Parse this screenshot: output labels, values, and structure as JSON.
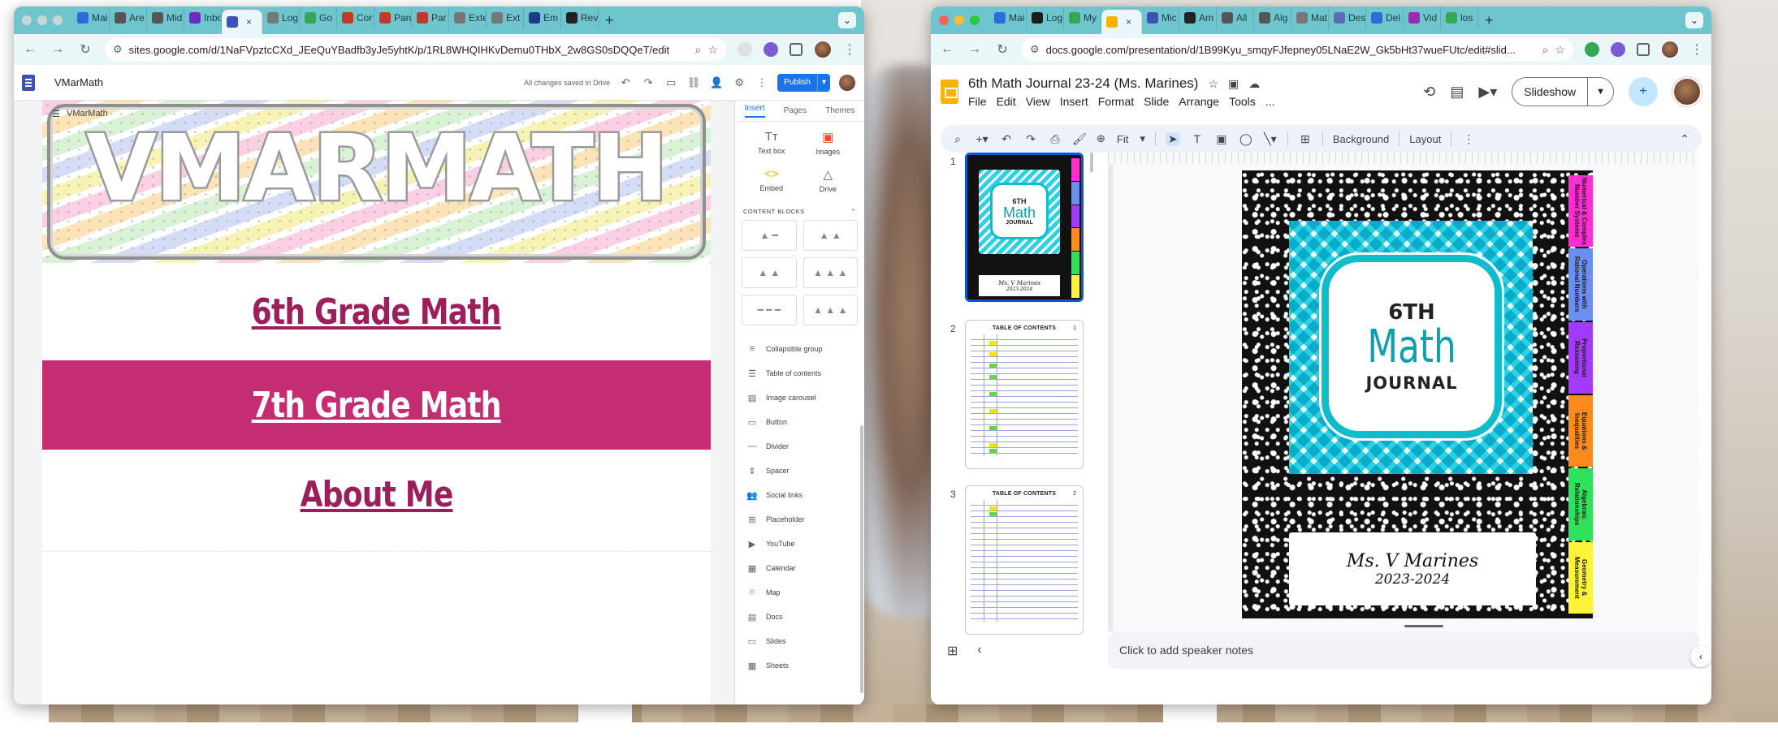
{
  "left_window": {
    "tabs": [
      {
        "label": "Mai",
        "fav": "#2b6cd9"
      },
      {
        "label": "Are",
        "fav": "#555555"
      },
      {
        "label": "Mid",
        "fav": "#555555"
      },
      {
        "label": "Inbo",
        "fav": "#6a2dc1"
      },
      {
        "label": "",
        "fav": "#3f51b5",
        "active": true
      },
      {
        "label": "Log",
        "fav": "#777777"
      },
      {
        "label": "Go",
        "fav": "#34a853"
      },
      {
        "label": "Cor",
        "fav": "#c0392b"
      },
      {
        "label": "Pan",
        "fav": "#c0392b"
      },
      {
        "label": "Par",
        "fav": "#c0392b"
      },
      {
        "label": "Exte",
        "fav": "#777777"
      },
      {
        "label": "Ext",
        "fav": "#777777"
      },
      {
        "label": "Em",
        "fav": "#1e3a8a"
      },
      {
        "label": "Rev",
        "fav": "#222222"
      }
    ],
    "url": "sites.google.com/d/1NaFVpztcCXd_JEeQuYBadfb3yJe5yhtK/p/1RL8WHQIHKvDemu0THbX_2w8GS0sDQQeT/edit",
    "site_name": "VMarMath",
    "saved_status": "All changes saved in Drive",
    "publish_label": "Publish",
    "banner_small_title": "VMarMath",
    "banner_title": "VMARMATH",
    "sections": [
      "6th Grade Math",
      "7th Grade Math",
      "About Me"
    ],
    "panel_tabs": [
      "Insert",
      "Pages",
      "Themes"
    ],
    "insert_items": [
      {
        "label": "Text box",
        "icon": "Tт"
      },
      {
        "label": "Images",
        "icon": "▣"
      },
      {
        "label": "Embed",
        "icon": "<>"
      },
      {
        "label": "Drive",
        "icon": "△"
      }
    ],
    "content_blocks_label": "CONTENT BLOCKS",
    "panel_items": [
      {
        "label": "Collapsible group",
        "icon": "≡"
      },
      {
        "label": "Table of contents",
        "icon": "☰"
      },
      {
        "label": "Image carousel",
        "icon": "▤"
      },
      {
        "label": "Button",
        "icon": "▭"
      },
      {
        "label": "Divider",
        "icon": "—"
      },
      {
        "label": "Spacer",
        "icon": "⇕"
      },
      {
        "label": "Social links",
        "icon": "👥"
      },
      {
        "label": "Placeholder",
        "icon": "⊞"
      },
      {
        "label": "YouTube",
        "icon": "▶"
      },
      {
        "label": "Calendar",
        "icon": "▦"
      },
      {
        "label": "Map",
        "icon": "⌾"
      },
      {
        "label": "Docs",
        "icon": "▤"
      },
      {
        "label": "Slides",
        "icon": "▭"
      },
      {
        "label": "Sheets",
        "icon": "▦"
      }
    ]
  },
  "right_window": {
    "tabs": [
      {
        "label": "Mai",
        "fav": "#2b6cd9"
      },
      {
        "label": "Log",
        "fav": "#1b1b1b"
      },
      {
        "label": "My",
        "fav": "#34a853"
      },
      {
        "label": "",
        "fav": "#f4b400",
        "active": true
      },
      {
        "label": "Mic",
        "fav": "#3f51b5"
      },
      {
        "label": "Am",
        "fav": "#222222"
      },
      {
        "label": "All",
        "fav": "#555555"
      },
      {
        "label": "Alg",
        "fav": "#555555"
      },
      {
        "label": "Mat",
        "fav": "#777777"
      },
      {
        "label": "Des",
        "fav": "#5f6ab8"
      },
      {
        "label": "Del",
        "fav": "#2b6cd9"
      },
      {
        "label": "Vid",
        "fav": "#9c27b0"
      },
      {
        "label": "los",
        "fav": "#34a853"
      }
    ],
    "url": "docs.google.com/presentation/d/1B99Kyu_smqyFJfepney05LNaE2W_Gk5bHt37wueFUtc/edit#slid...",
    "doc_title": "6th Math Journal 23-24 (Ms. Marines)",
    "menu": [
      "File",
      "Edit",
      "View",
      "Insert",
      "Format",
      "Slide",
      "Arrange",
      "Tools",
      "..."
    ],
    "slideshow_label": "Slideshow",
    "zoom_label": "Fit",
    "background_label": "Background",
    "layout_label": "Layout",
    "thumbnails": [
      {
        "number": "1"
      },
      {
        "number": "2",
        "title": "TABLE OF CONTENTS",
        "page": "1"
      },
      {
        "number": "3",
        "title": "TABLE OF CONTENTS",
        "page": "2"
      }
    ],
    "slide": {
      "grade": "6TH",
      "subject": "Math",
      "journal": "JOURNAL",
      "teacher": "Ms. V Marines",
      "year": "2023-2024",
      "tabs": [
        {
          "label": "Numerical & Complex Number Systems",
          "color": "#ff2ed1"
        },
        {
          "label": "Operations with Rational Numbers",
          "color": "#6b8ff0"
        },
        {
          "label": "Proportional Reasoning",
          "color": "#a23bff"
        },
        {
          "label": "Equations & Inequalities",
          "color": "#ff8a1e"
        },
        {
          "label": "Algebraic Relationships",
          "color": "#2ee35a"
        },
        {
          "label": "Geometry & Measurement",
          "color": "#fff23a"
        }
      ]
    },
    "speaker_notes_placeholder": "Click to add speaker notes"
  }
}
